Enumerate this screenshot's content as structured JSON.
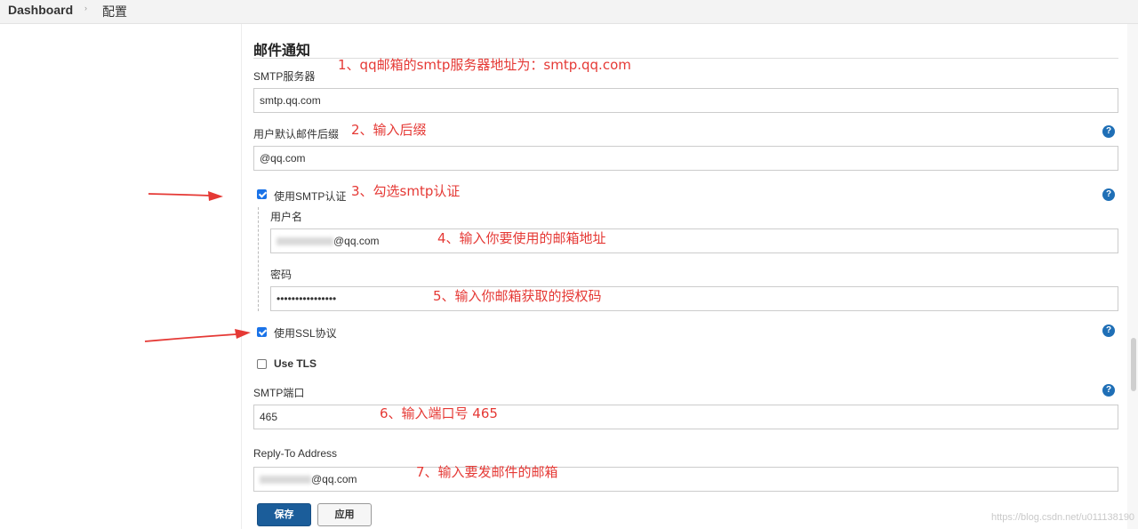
{
  "breadcrumb": {
    "home": "Dashboard",
    "separator": "›",
    "current": "配置"
  },
  "section": {
    "title": "邮件通知"
  },
  "fields": {
    "smtp_server": {
      "label": "SMTP服务器",
      "value": "smtp.qq.com"
    },
    "default_suffix": {
      "label": "用户默认邮件后缀",
      "value": "@qq.com"
    },
    "use_smtp_auth": {
      "label": "使用SMTP认证",
      "checked": true
    },
    "username": {
      "label": "用户名",
      "value_suffix": "@qq.com"
    },
    "password": {
      "label": "密码",
      "value": "••••••••••••••••"
    },
    "use_ssl": {
      "label": "使用SSL协议",
      "checked": true
    },
    "use_tls": {
      "label": "Use TLS",
      "checked": false
    },
    "smtp_port": {
      "label": "SMTP端口",
      "value": "465"
    },
    "reply_to": {
      "label": "Reply-To Address",
      "value_suffix": "@qq.com"
    }
  },
  "help_icon": {
    "glyph": "?"
  },
  "buttons": {
    "save": "保存",
    "apply": "应用"
  },
  "annotations": {
    "a1": "1、qq邮箱的smtp服务器地址为：smtp.qq.com",
    "a2": "2、输入后缀",
    "a3": "3、勾选smtp认证",
    "a4": "4、输入你要使用的邮箱地址",
    "a5": "5、输入你邮箱获取的授权码",
    "a6": "6、输入端口号 465",
    "a7": "7、输入要发邮件的邮箱"
  },
  "watermark": "https://blog.csdn.net/u011138190",
  "colors": {
    "annotation": "#e53935",
    "primary": "#1b5d9a",
    "help": "#1f6fb6",
    "checkbox": "#1a73e8"
  }
}
